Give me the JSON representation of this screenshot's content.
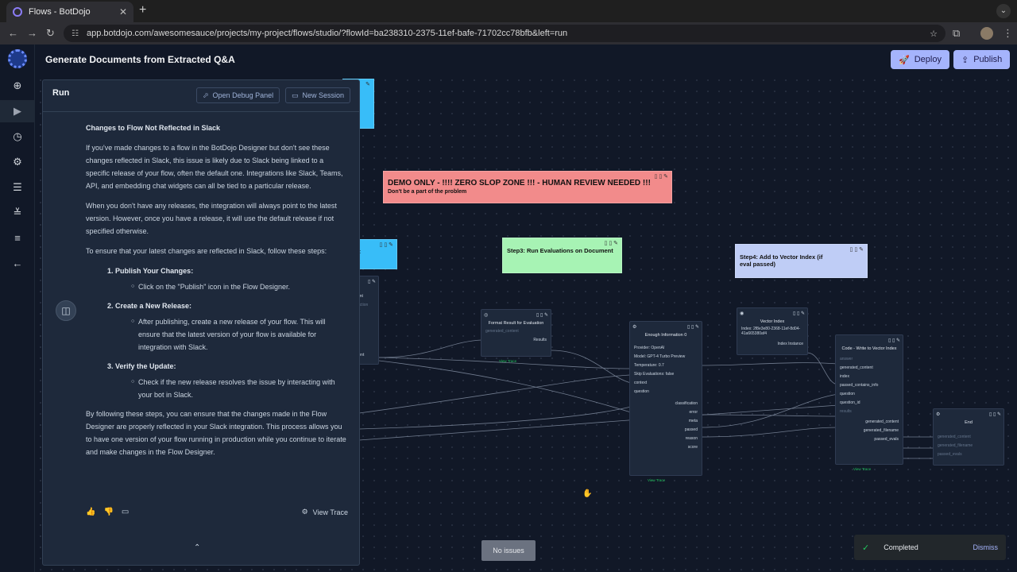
{
  "browser": {
    "tab_title": "Flows - BotDojo",
    "url": "app.botdojo.com/awesomesauce/projects/my-project/flows/studio/?flowId=ba238310-2375-11ef-bafe-71702cc78bfb&left=run"
  },
  "header": {
    "title": "Generate Documents from Extracted Q&A",
    "deploy_label": "Deploy",
    "publish_label": "Publish"
  },
  "run_panel": {
    "title": "Run",
    "debug_label": "Open Debug Panel",
    "session_label": "New Session",
    "heading": "Changes to Flow Not Reflected in Slack",
    "p1": "If you've made changes to a flow in the BotDojo Designer but don't see these changes reflected in Slack, this issue is likely due to Slack being linked to a specific release of your flow, often the default one. Integrations like Slack, Teams, API, and embedding chat widgets can all be tied to a particular release.",
    "p2": "When you don't have any releases, the integration will always point to the latest version. However, once you have a release, it will use the default release if not specified otherwise.",
    "p3": "To ensure that your latest changes are reflected in Slack, follow these steps:",
    "step1": "1. Publish Your Changes:",
    "step1_sub": "Click on the \"Publish\" icon in the Flow Designer.",
    "step2": "2. Create a New Release:",
    "step2_sub": "After publishing, create a new release of your flow. This will ensure that the latest version of your flow is available for integration with Slack.",
    "step3": "3. Verify the Update:",
    "step3_sub": "Check if the new release resolves the issue by interacting with your bot in Slack.",
    "p4": "By following these steps, you can ensure that the changes made in the Flow Designer are properly reflected in your Slack integration. This process allows you to have one version of your flow running in production while you continue to iterate and make changes in the Flow Designer.",
    "view_trace": "View Trace"
  },
  "canvas": {
    "notes": {
      "demo_title": "DEMO ONLY - !!!! ZERO SLOP ZONE !!! - HUMAN REVIEW NEEDED !!!",
      "demo_sub": "Don't be a part of the problem",
      "step3": "Step3: Run Evaluations on Document",
      "step4": "Step4: Add to Vector Index (if eval passed)",
      "left_note_text": "ment",
      "top_note_text": "ew"
    },
    "nodes": {
      "format": {
        "title": "Format Result for Evaluation",
        "in1": "generated_content",
        "out1": "Results",
        "footer": "View Trace"
      },
      "enough": {
        "title": "Enough Information 0",
        "provider": "Provider: OpenAI",
        "model": "Model: GPT-4 Turbo Preview",
        "temperature": "Temperature: 0.7",
        "skip": "Skip Evaluations: false",
        "in1": "context",
        "in2": "question",
        "out1": "classification",
        "out2": "error",
        "out3": "meta",
        "out4": "passed",
        "out5": "reason",
        "out6": "score",
        "footer": "View Trace"
      },
      "vector": {
        "title": "Vector Index",
        "index": "Index: 2f8e3e80-2368-11ef-8d04-41a665380af4",
        "out1": "Index Instance"
      },
      "code": {
        "title": "Code - Write to Vector Index",
        "in1": "answer",
        "in2": "generated_content",
        "in3": "index",
        "in4": "passed_contains_info",
        "in5": "question",
        "in6": "question_id",
        "in7": "results",
        "out1": "generated_content",
        "out2": "generated_filename",
        "out3": "passed_evals",
        "footer": "View Trace"
      },
      "end": {
        "title": "End",
        "in1": "generated_content",
        "in2": "generated_filename",
        "in3": "passed_evals"
      },
      "partial": {
        "row1": "ent",
        "row2": "action",
        "row3": "tent"
      }
    }
  },
  "status": {
    "no_issues": "No issues",
    "toast": "Completed",
    "dismiss": "Dismiss"
  },
  "colors": {
    "accent": "#a5b4fc",
    "demo_note": "#f28b8b",
    "step3_note": "#a7f3b4",
    "step4_note": "#bfcdf6",
    "blue_note": "#38bdf8"
  }
}
